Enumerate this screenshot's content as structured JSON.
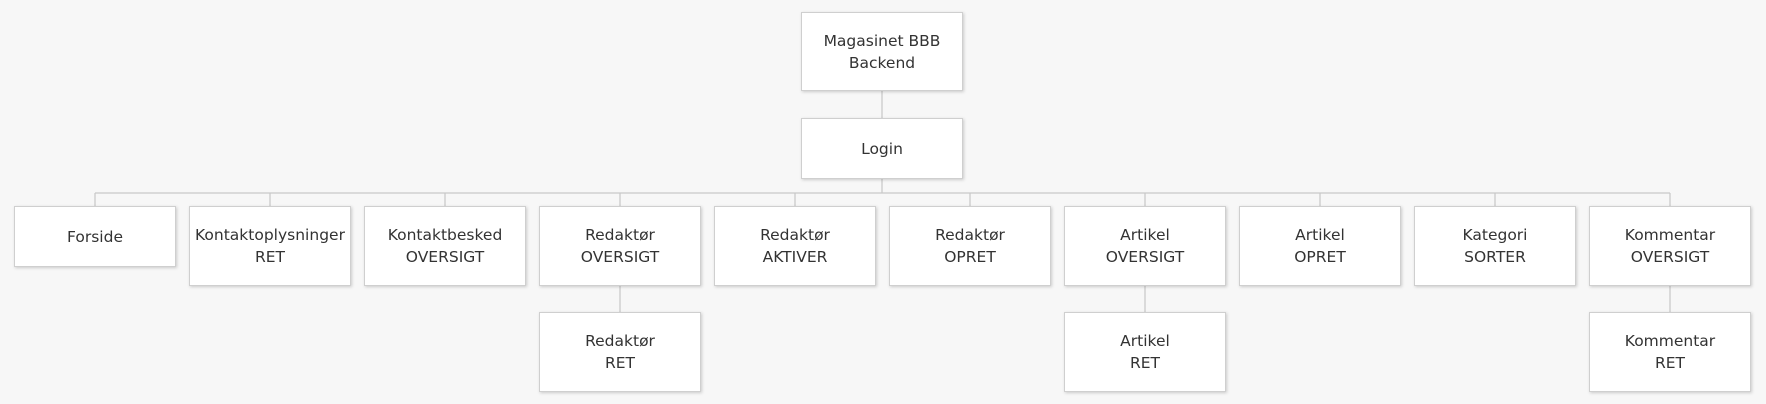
{
  "sitemap": {
    "root": {
      "line1": "Magasinet BBB",
      "line2": "Backend"
    },
    "login": {
      "line1": "Login"
    },
    "pages": [
      {
        "line1": "Forside"
      },
      {
        "line1": "Kontaktoplysninger",
        "line2": "RET"
      },
      {
        "line1": "Kontaktbesked",
        "line2": "OVERSIGT"
      },
      {
        "line1": "Redaktør",
        "line2": "OVERSIGT"
      },
      {
        "line1": "Redaktør",
        "line2": "AKTIVER"
      },
      {
        "line1": "Redaktør",
        "line2": "OPRET"
      },
      {
        "line1": "Artikel",
        "line2": "OVERSIGT"
      },
      {
        "line1": "Artikel",
        "line2": "OPRET"
      },
      {
        "line1": "Kategori",
        "line2": "SORTER"
      },
      {
        "line1": "Kommentar",
        "line2": "OVERSIGT"
      }
    ],
    "subpages": [
      {
        "line1": "Redaktør",
        "line2": "RET"
      },
      {
        "line1": "Artikel",
        "line2": "RET"
      },
      {
        "line1": "Kommentar",
        "line2": "RET"
      }
    ]
  }
}
